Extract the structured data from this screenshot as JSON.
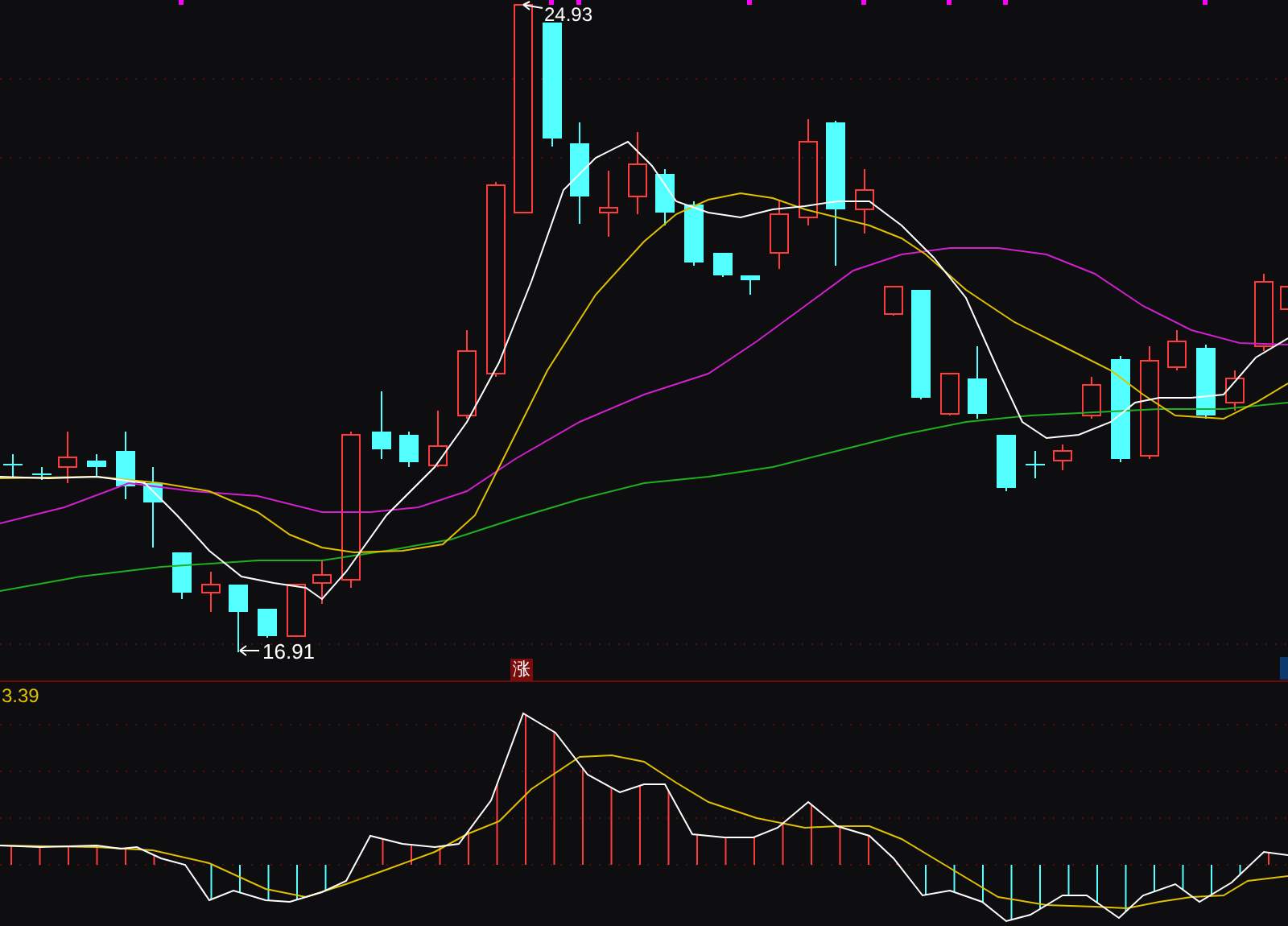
{
  "price_chart": {
    "high_label": "24.93",
    "low_label": "16.91",
    "event_marker": "涨"
  },
  "macd_panel": {
    "value_label": "3.39"
  }
}
